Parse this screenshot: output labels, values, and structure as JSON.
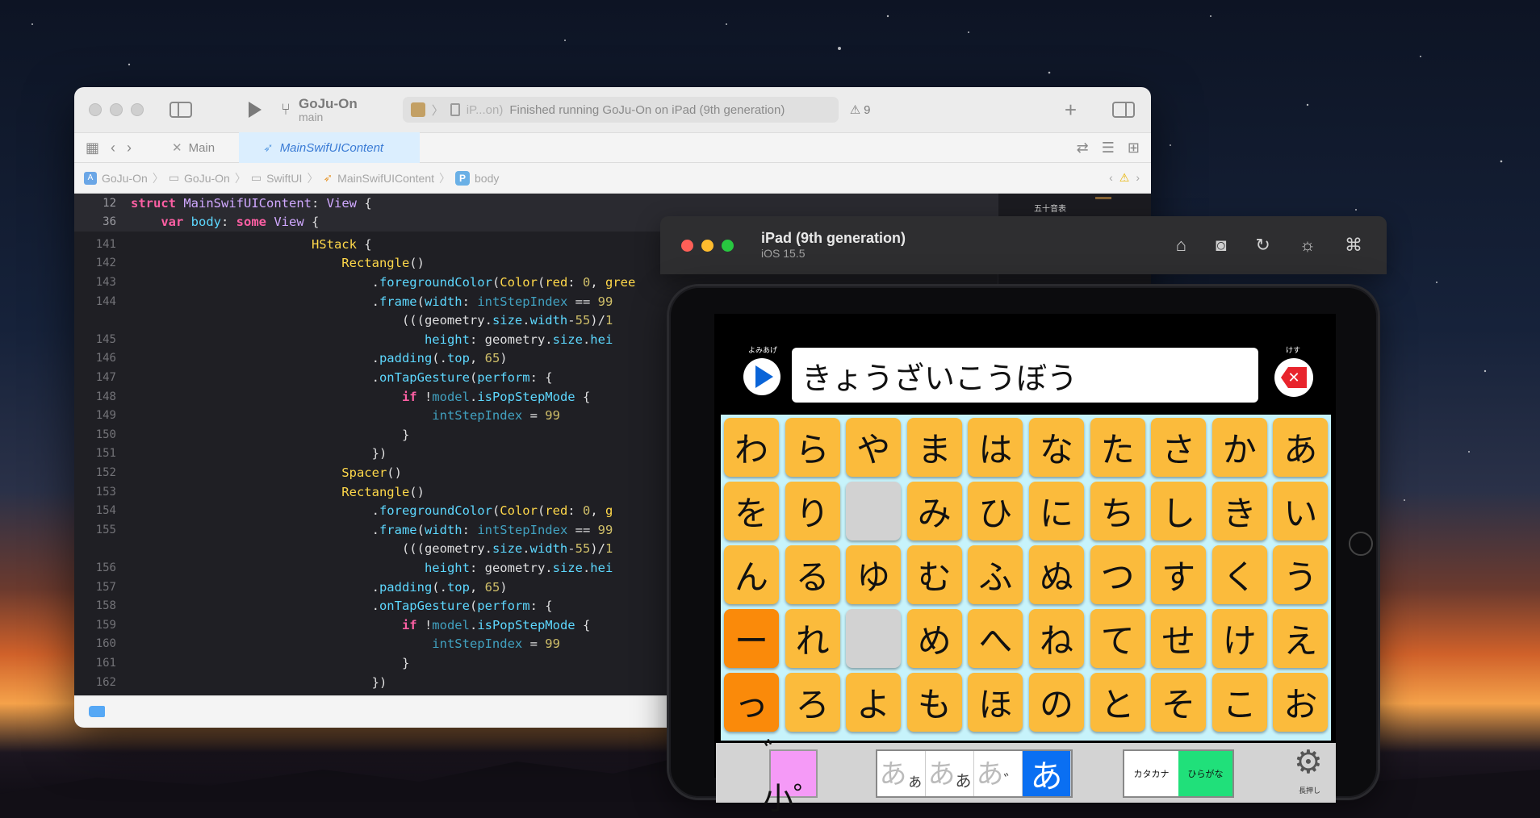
{
  "xcode": {
    "scheme_name": "GoJu-On",
    "branch": "main",
    "activity_text": "Finished running GoJu-On on iPad (9th generation)",
    "activity_device": "iP...on)",
    "warning_count": "9",
    "tabs": [
      {
        "label": "Main"
      },
      {
        "label": "MainSwifUIContent"
      }
    ],
    "breadcrumb": [
      "GoJu-On",
      "GoJu-On",
      "SwiftUI",
      "MainSwifUIContent",
      "body"
    ],
    "minimap_label": "五十音表"
  },
  "code_lines": [
    {
      "ln": "12",
      "sticky": true
    },
    {
      "ln": "36",
      "sticky": true
    },
    {
      "ln": "141"
    },
    {
      "ln": "142"
    },
    {
      "ln": "143"
    },
    {
      "ln": "144"
    },
    {
      "ln": ""
    },
    {
      "ln": "145"
    },
    {
      "ln": "146"
    },
    {
      "ln": "147"
    },
    {
      "ln": "148"
    },
    {
      "ln": "149"
    },
    {
      "ln": "150"
    },
    {
      "ln": "151"
    },
    {
      "ln": "152"
    },
    {
      "ln": "153"
    },
    {
      "ln": "154"
    },
    {
      "ln": "155"
    },
    {
      "ln": ""
    },
    {
      "ln": "156"
    },
    {
      "ln": "157"
    },
    {
      "ln": "158"
    },
    {
      "ln": "159"
    },
    {
      "ln": "160"
    },
    {
      "ln": "161"
    },
    {
      "ln": "162"
    }
  ],
  "simulator": {
    "device_name": "iPad (9th generation)",
    "os_version": "iOS 15.5"
  },
  "app": {
    "yomiage_label": "よみあげ",
    "kesu_label": "けす",
    "input_text": "きょうざいこうぼう",
    "delete_glyph": "✕",
    "columns": [
      [
        "わ",
        "を",
        "ん",
        "ー",
        "っ"
      ],
      [
        "ら",
        "り",
        "る",
        "れ",
        "ろ"
      ],
      [
        "や",
        "",
        "ゆ",
        "",
        "よ"
      ],
      [
        "ま",
        "み",
        "む",
        "め",
        "も"
      ],
      [
        "は",
        "ひ",
        "ふ",
        "へ",
        "ほ"
      ],
      [
        "な",
        "に",
        "ぬ",
        "ね",
        "の"
      ],
      [
        "た",
        "ち",
        "つ",
        "て",
        "と"
      ],
      [
        "さ",
        "し",
        "す",
        "せ",
        "そ"
      ],
      [
        "か",
        "き",
        "く",
        "け",
        "こ"
      ],
      [
        "あ",
        "い",
        "う",
        "え",
        "お"
      ]
    ],
    "small_button": "゛小゜",
    "size_segments": [
      {
        "big": "あ",
        "small": "ぁ"
      },
      {
        "big": "あ",
        "small": "あ"
      },
      {
        "big": "あ",
        "small": "゛"
      },
      {
        "big": "あ",
        "small": ""
      }
    ],
    "kana_segments": [
      "カタカナ",
      "ひらがな"
    ],
    "long_press_label": "長押し",
    "colors": {
      "key": "#fbbb3c",
      "key_special": "#fa8a0a",
      "keyboard_bg": "#c7f3fb",
      "play": "#0a64d8",
      "delete": "#e8242c",
      "small_toggle": "#f59af7",
      "size_active": "#0a6ff2",
      "kana_active": "#20e07a"
    }
  }
}
